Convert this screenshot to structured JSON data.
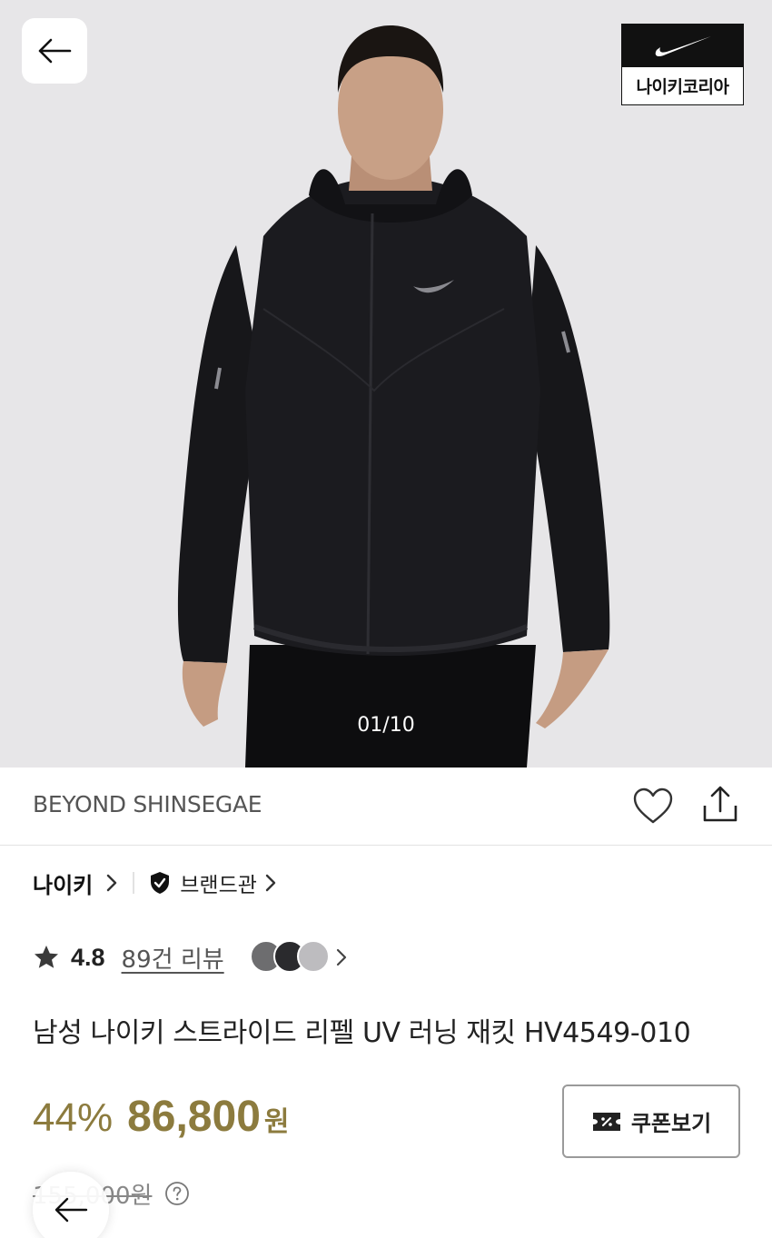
{
  "hero": {
    "brand_badge_label": "나이키코리아",
    "image_counter": "01/10"
  },
  "seller": {
    "name": "BEYOND SHINSEGAE"
  },
  "brand": {
    "name": "나이키",
    "shop_label": "브랜드관"
  },
  "rating": {
    "score": "4.8",
    "review_link": "89건 리뷰"
  },
  "product": {
    "title": "남성 나이키 스트라이드 리펠 UV 러닝 재킷 HV4549-010"
  },
  "price": {
    "discount": "44%",
    "sale": "86,800",
    "currency": "원",
    "original": "155,000원",
    "coupon_label": "쿠폰보기"
  },
  "colors": {
    "accent_gold": "#8c7b3e",
    "hero_bg": "#e7e6e8"
  },
  "icons": [
    "arrow-left-icon",
    "nike-swoosh-icon",
    "heart-icon",
    "share-icon",
    "chevron-right-icon",
    "shield-check-icon",
    "star-icon",
    "coupon-icon",
    "help-icon"
  ]
}
